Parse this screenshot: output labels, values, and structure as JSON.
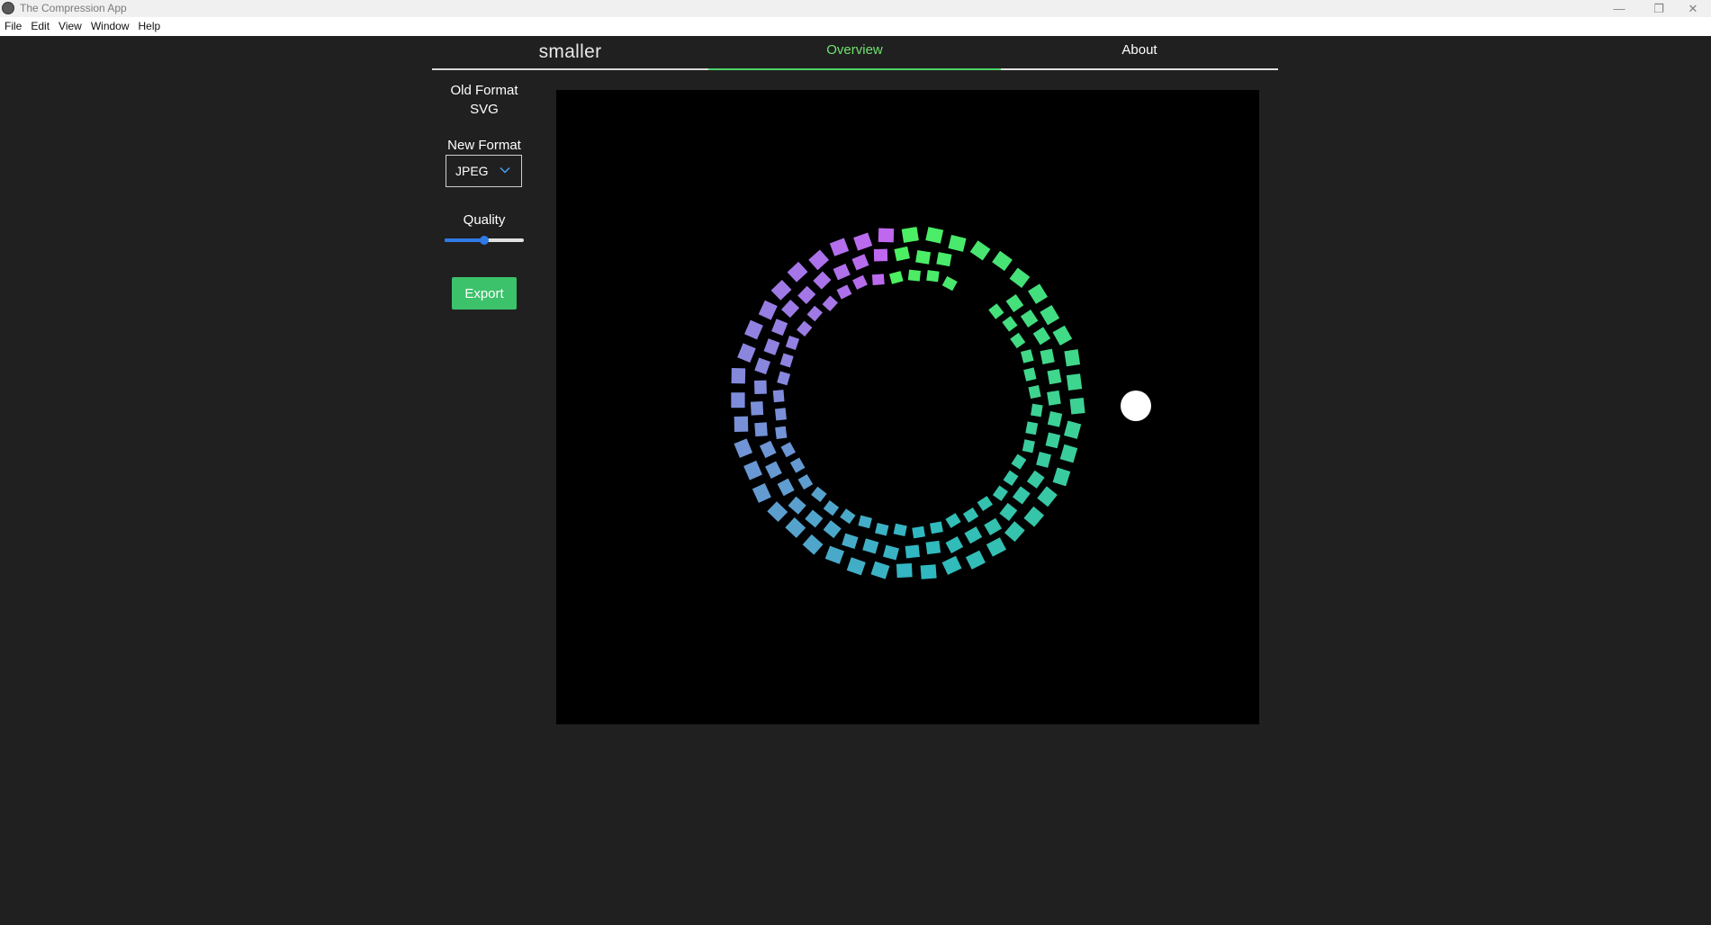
{
  "window": {
    "title": "The Compression App",
    "minimize_glyph": "—",
    "restore_glyph": "❐",
    "close_glyph": "✕"
  },
  "menu": {
    "items": [
      "File",
      "Edit",
      "View",
      "Window",
      "Help"
    ]
  },
  "nav": {
    "brand": "smaller",
    "tabs": [
      {
        "label": "Overview",
        "active": true
      },
      {
        "label": "About",
        "active": false
      }
    ]
  },
  "sidebar": {
    "old_format_label": "Old Format",
    "old_format_value": "SVG",
    "new_format_label": "New Format",
    "new_format_value": "JPEG",
    "quality_label": "Quality",
    "quality_value": 0.5,
    "export_label": "Export"
  },
  "preview": {
    "background": "#000000",
    "gradient_start": "#c266f0",
    "gradient_mid": "#2fb8c0",
    "gradient_end": "#4df060",
    "dot_color": "#ffffff"
  },
  "colors": {
    "app_background": "#202020",
    "accent_green": "#3cc26a",
    "active_tab": "#6ee36e",
    "slider_blue": "#2f7ae5"
  }
}
